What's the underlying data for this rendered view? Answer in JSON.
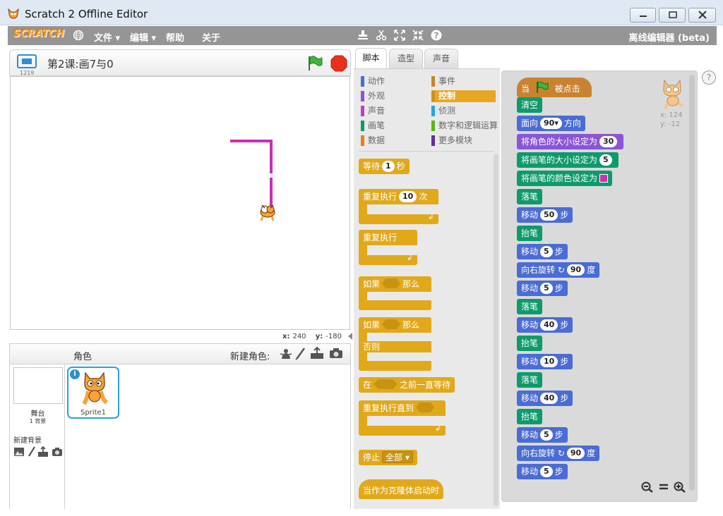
{
  "window": {
    "title": "Scratch 2 Offline Editor"
  },
  "menubar": {
    "logo": "SCRATCH",
    "items": [
      "文件 ▾",
      "编辑 ▾",
      "帮助",
      "关于"
    ],
    "right_label": "离线编辑器 (beta)"
  },
  "stage": {
    "number": "1219",
    "project_title": "第2课:画7与0",
    "coords_x_label": "x:",
    "coords_x": "240",
    "coords_y_label": "y:",
    "coords_y": "-180"
  },
  "sprites_pane": {
    "title": "角色",
    "new_sprite_label": "新建角色:",
    "stage_name": "舞台",
    "backdrop_count": "1 背景",
    "new_backdrop_label": "新建背景",
    "sprite_name": "Sprite1"
  },
  "tabs": [
    "脚本",
    "造型",
    "声音"
  ],
  "categories": {
    "left": [
      {
        "label": "动作",
        "color": "#4a6cd4"
      },
      {
        "label": "外观",
        "color": "#8a55d7"
      },
      {
        "label": "声音",
        "color": "#bb42c3"
      },
      {
        "label": "画笔",
        "color": "#0e9a6c"
      },
      {
        "label": "数据",
        "color": "#ee7d16"
      }
    ],
    "right": [
      {
        "label": "事件",
        "color": "#c88330"
      },
      {
        "label": "控制",
        "color": "#e1a91a"
      },
      {
        "label": "侦测",
        "color": "#2ca5e2"
      },
      {
        "label": "数字和逻辑运算",
        "color": "#5cb712"
      },
      {
        "label": "更多模块",
        "color": "#632d99"
      }
    ],
    "selected": "控制"
  },
  "palette_blocks": {
    "wait": {
      "pre": "等待",
      "val": "1",
      "post": "秒"
    },
    "repeat": {
      "pre": "重复执行",
      "val": "10",
      "post": "次"
    },
    "forever": "重复执行",
    "if_then": {
      "pre": "如果",
      "post": "那么"
    },
    "if_else": {
      "pre": "如果",
      "post": "那么",
      "else": "否则"
    },
    "wait_until": {
      "pre": "在",
      "post": "之前一直等待"
    },
    "repeat_until": "重复执行直到",
    "stop": {
      "pre": "停止",
      "val": "全部"
    },
    "clone_hat": "当作为克隆体启动时"
  },
  "script": {
    "hat": {
      "pre": "当",
      "post": "被点击"
    },
    "blocks": [
      {
        "type": "pen",
        "text": "清空"
      },
      {
        "type": "motion",
        "pre": "面向",
        "val": "90▾",
        "post": "方向"
      },
      {
        "type": "looks",
        "pre": "将角色的大小设定为",
        "val": "30",
        "post": ""
      },
      {
        "type": "pen",
        "pre": "将画笔的大小设定为",
        "val": "5",
        "post": ""
      },
      {
        "type": "pen",
        "pre": "将画笔的颜色设定为",
        "color": "#d42bb8"
      },
      {
        "type": "pen",
        "text": "落笔"
      },
      {
        "type": "motion",
        "pre": "移动",
        "val": "50",
        "post": "步"
      },
      {
        "type": "pen",
        "text": "抬笔"
      },
      {
        "type": "motion",
        "pre": "移动",
        "val": "5",
        "post": "步"
      },
      {
        "type": "motion",
        "pre": "向右旋转 ↻",
        "val": "90",
        "post": "度"
      },
      {
        "type": "motion",
        "pre": "移动",
        "val": "5",
        "post": "步"
      },
      {
        "type": "pen",
        "text": "落笔"
      },
      {
        "type": "motion",
        "pre": "移动",
        "val": "40",
        "post": "步"
      },
      {
        "type": "pen",
        "text": "抬笔"
      },
      {
        "type": "motion",
        "pre": "移动",
        "val": "10",
        "post": "步"
      },
      {
        "type": "pen",
        "text": "落笔"
      },
      {
        "type": "motion",
        "pre": "移动",
        "val": "40",
        "post": "步"
      },
      {
        "type": "pen",
        "text": "抬笔"
      },
      {
        "type": "motion",
        "pre": "移动",
        "val": "5",
        "post": "步"
      },
      {
        "type": "motion",
        "pre": "向右旋转 ↻",
        "val": "90",
        "post": "度"
      },
      {
        "type": "motion",
        "pre": "移动",
        "val": "5",
        "post": "步"
      }
    ]
  },
  "sprite_info": {
    "x": "x: 124",
    "y": "y: -12"
  },
  "help": "?",
  "colors": {
    "pen_line": "#c92fb5",
    "accent": "#e6a824"
  }
}
